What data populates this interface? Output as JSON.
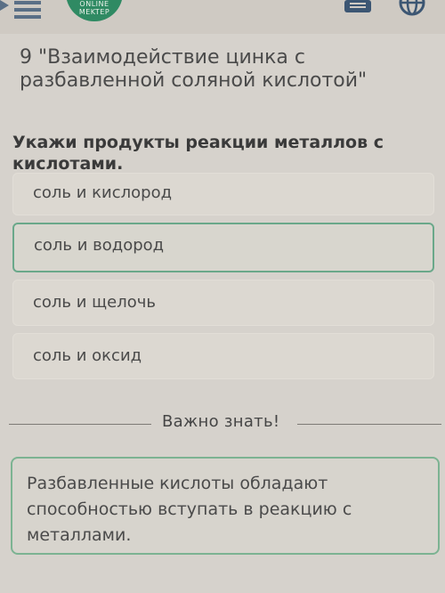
{
  "header": {
    "logo_line1": "ONLINE",
    "logo_line2": "MEKTEP"
  },
  "lesson": {
    "title": "9 \"Взаимодействие цинка с разбавленной соляной кислотой\""
  },
  "question": {
    "text": "Укажи продукты реакции металлов с кислотами.",
    "options": [
      {
        "label": "соль и кислород",
        "selected": false
      },
      {
        "label": "соль и водород",
        "selected": true
      },
      {
        "label": "соль и щелочь",
        "selected": false
      },
      {
        "label": "соль и оксид",
        "selected": false
      }
    ]
  },
  "info": {
    "heading": "Важно знать!",
    "text": "Разбавленные кислоты обладают способностью вступать в реакцию с металлами."
  },
  "colors": {
    "accent": "#6aa88a",
    "logo": "#2f8a63"
  },
  "icons": [
    "menu-icon",
    "book-icon",
    "globe-icon"
  ]
}
